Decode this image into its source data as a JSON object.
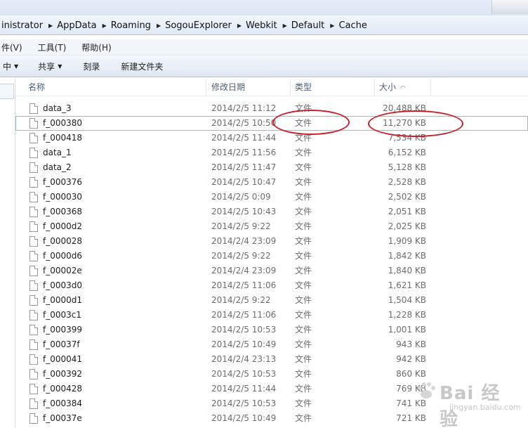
{
  "address": {
    "crumbs": [
      "inistrator",
      "AppData",
      "Roaming",
      "SogouExplorer",
      "Webkit",
      "Default",
      "Cache"
    ]
  },
  "menu": {
    "items": [
      "件(V)",
      "工具(T)",
      "帮助(H)"
    ]
  },
  "toolbar": {
    "buttons": [
      {
        "label": "中",
        "has_caret": true
      },
      {
        "label": "共享",
        "has_caret": true
      },
      {
        "label": "刻录",
        "has_caret": false
      },
      {
        "label": "新建文件夹",
        "has_caret": false
      }
    ]
  },
  "columns": {
    "name": "名称",
    "date": "修改日期",
    "type": "类型",
    "size": "大小"
  },
  "files": [
    {
      "name": "data_3",
      "date": "2014/2/5 11:12",
      "type": "文件",
      "size": "20,488 KB"
    },
    {
      "name": "f_000380",
      "date": "2014/2/5 10:50",
      "type": "文件",
      "size": "11,270 KB",
      "selected": true
    },
    {
      "name": "f_000418",
      "date": "2014/2/5 11:44",
      "type": "文件",
      "size": "7,534 KB"
    },
    {
      "name": "data_1",
      "date": "2014/2/5 11:56",
      "type": "文件",
      "size": "6,152 KB"
    },
    {
      "name": "data_2",
      "date": "2014/2/5 11:47",
      "type": "文件",
      "size": "5,128 KB"
    },
    {
      "name": "f_000376",
      "date": "2014/2/5 10:47",
      "type": "文件",
      "size": "2,528 KB"
    },
    {
      "name": "f_000030",
      "date": "2014/2/5 0:09",
      "type": "文件",
      "size": "2,502 KB"
    },
    {
      "name": "f_000368",
      "date": "2014/2/5 10:43",
      "type": "文件",
      "size": "2,051 KB"
    },
    {
      "name": "f_0000d2",
      "date": "2014/2/5 9:22",
      "type": "文件",
      "size": "2,025 KB"
    },
    {
      "name": "f_000028",
      "date": "2014/2/4 23:09",
      "type": "文件",
      "size": "1,909 KB"
    },
    {
      "name": "f_0000d6",
      "date": "2014/2/5 9:22",
      "type": "文件",
      "size": "1,842 KB"
    },
    {
      "name": "f_00002e",
      "date": "2014/2/4 23:09",
      "type": "文件",
      "size": "1,840 KB"
    },
    {
      "name": "f_0003d0",
      "date": "2014/2/5 11:06",
      "type": "文件",
      "size": "1,621 KB"
    },
    {
      "name": "f_0000d1",
      "date": "2014/2/5 9:22",
      "type": "文件",
      "size": "1,504 KB"
    },
    {
      "name": "f_0003c1",
      "date": "2014/2/5 11:06",
      "type": "文件",
      "size": "1,228 KB"
    },
    {
      "name": "f_000399",
      "date": "2014/2/5 10:53",
      "type": "文件",
      "size": "1,001 KB"
    },
    {
      "name": "f_00037f",
      "date": "2014/2/5 10:49",
      "type": "文件",
      "size": "943 KB"
    },
    {
      "name": "f_000041",
      "date": "2014/2/4 23:13",
      "type": "文件",
      "size": "942 KB"
    },
    {
      "name": "f_000392",
      "date": "2014/2/5 10:53",
      "type": "文件",
      "size": "860 KB"
    },
    {
      "name": "f_000428",
      "date": "2014/2/5 11:44",
      "type": "文件",
      "size": "769 KB"
    },
    {
      "name": "f_000384",
      "date": "2014/2/5 10:53",
      "type": "文件",
      "size": "741 KB"
    },
    {
      "name": "f_00037e",
      "date": "2014/2/5 10:49",
      "type": "文件",
      "size": "721 KB"
    }
  ],
  "annotation": {
    "color": "#c81e2a",
    "marks": [
      "type-of-selected-row",
      "size-of-selected-row"
    ]
  },
  "watermark": {
    "text": "Bai 经验",
    "sub": "jingyan.baidu.com"
  },
  "colors": {
    "toolbar_bg": "#dde7f3",
    "header_text": "#4c607a",
    "selection_border": "#9fb7d3"
  }
}
